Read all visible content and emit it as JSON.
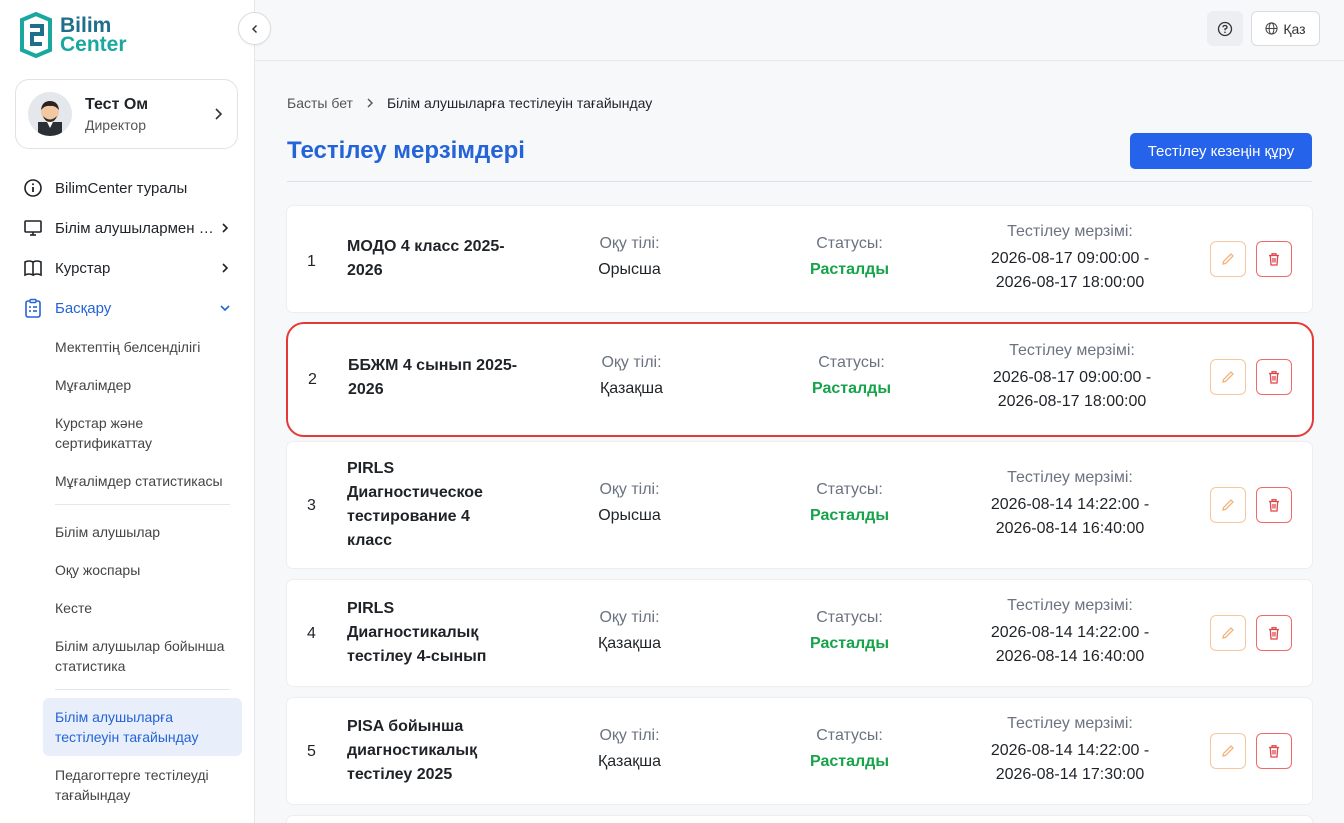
{
  "logo": {
    "line1": "Bilim",
    "line2": "Center"
  },
  "profile": {
    "name": "Тест Ом",
    "role": "Директор"
  },
  "nav": {
    "about": "BilimCenter туралы",
    "students": "Білім алушылармен жұмыс",
    "courses": "Курстар",
    "manage": "Басқару",
    "sub": [
      "Мектептің белсенділігі",
      "Мұғалімдер",
      "Курстар және сертификаттау",
      "Мұғалімдер статистикасы",
      "Білім алушылар",
      "Оқу жоспары",
      "Кесте",
      "Білім алушылар бойынша статистика"
    ],
    "active_sub": "Білім алушыларға тестілеуін тағайындау",
    "last_sub": "Педагогтерге тестілеуді тағайындау"
  },
  "topbar": {
    "lang": "Қаз"
  },
  "breadcrumb": {
    "home": "Басты бет",
    "current": "Білім алушыларға тестілеуін тағайындау"
  },
  "page": {
    "title": "Тестілеу мерзімдері",
    "create_button": "Тестілеу кезеңін құру"
  },
  "labels": {
    "lang": "Оқу тілі:",
    "status": "Статусы:",
    "date": "Тестілеу мерзімі:"
  },
  "rows": [
    {
      "num": "1",
      "name": "МОДО 4 класс 2025-2026",
      "lang": "Орысша",
      "status": "Расталды",
      "start": "2026-08-17 09:00:00 -",
      "end": "2026-08-17 18:00:00"
    },
    {
      "num": "2",
      "name": "ББЖМ 4 сынып 2025-2026",
      "lang": "Қазақша",
      "status": "Расталды",
      "start": "2026-08-17 09:00:00 -",
      "end": "2026-08-17 18:00:00"
    },
    {
      "num": "3",
      "name": "PIRLS Диагностическое тестирование 4 класс",
      "lang": "Орысша",
      "status": "Расталды",
      "start": "2026-08-14 14:22:00 -",
      "end": "2026-08-14 16:40:00"
    },
    {
      "num": "4",
      "name": "PIRLS Диагностикалық тестілеу 4-сынып",
      "lang": "Қазақша",
      "status": "Расталды",
      "start": "2026-08-14 14:22:00 -",
      "end": "2026-08-14 16:40:00"
    },
    {
      "num": "5",
      "name": "PISA бойынша диагностикалық тестілеу 2025",
      "lang": "Қазақша",
      "status": "Расталды",
      "start": "2026-08-14 14:22:00 -",
      "end": "2026-08-14 17:30:00"
    }
  ],
  "colors": {
    "accent": "#2563eb",
    "status_ok": "#16a34a",
    "highlight": "#e53935"
  }
}
